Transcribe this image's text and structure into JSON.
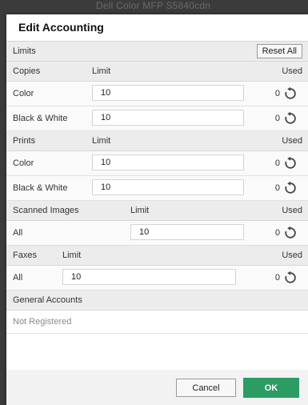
{
  "backdrop": {
    "title": "Dell Color MFP S5840cdn"
  },
  "dialog": {
    "title": "Edit Accounting",
    "reset_all_label": "Reset All",
    "limits_label": "Limits",
    "copies": {
      "header": "Copies",
      "limit_col": "Limit",
      "used_col": "Used",
      "rows": [
        {
          "label": "Color",
          "limit": "10",
          "used": "0"
        },
        {
          "label": "Black & White",
          "limit": "10",
          "used": "0"
        }
      ]
    },
    "prints": {
      "header": "Prints",
      "limit_col": "Limit",
      "used_col": "Used",
      "rows": [
        {
          "label": "Color",
          "limit": "10",
          "used": "0"
        },
        {
          "label": "Black & White",
          "limit": "10",
          "used": "0"
        }
      ]
    },
    "scanned": {
      "header": "Scanned Images",
      "limit_col": "Limit",
      "used_col": "Used",
      "rows": [
        {
          "label": "All",
          "limit": "10",
          "used": "0"
        }
      ]
    },
    "faxes": {
      "header": "Faxes",
      "limit_col": "Limit",
      "used_col": "Used",
      "rows": [
        {
          "label": "All",
          "limit": "10",
          "used": "0"
        }
      ]
    },
    "general": {
      "header": "General Accounts",
      "status": "Not Registered"
    },
    "cancel_label": "Cancel",
    "ok_label": "OK",
    "colors": {
      "ok_button": "#2d9c63"
    },
    "icons": {
      "reset": "reset-counter-icon"
    }
  }
}
